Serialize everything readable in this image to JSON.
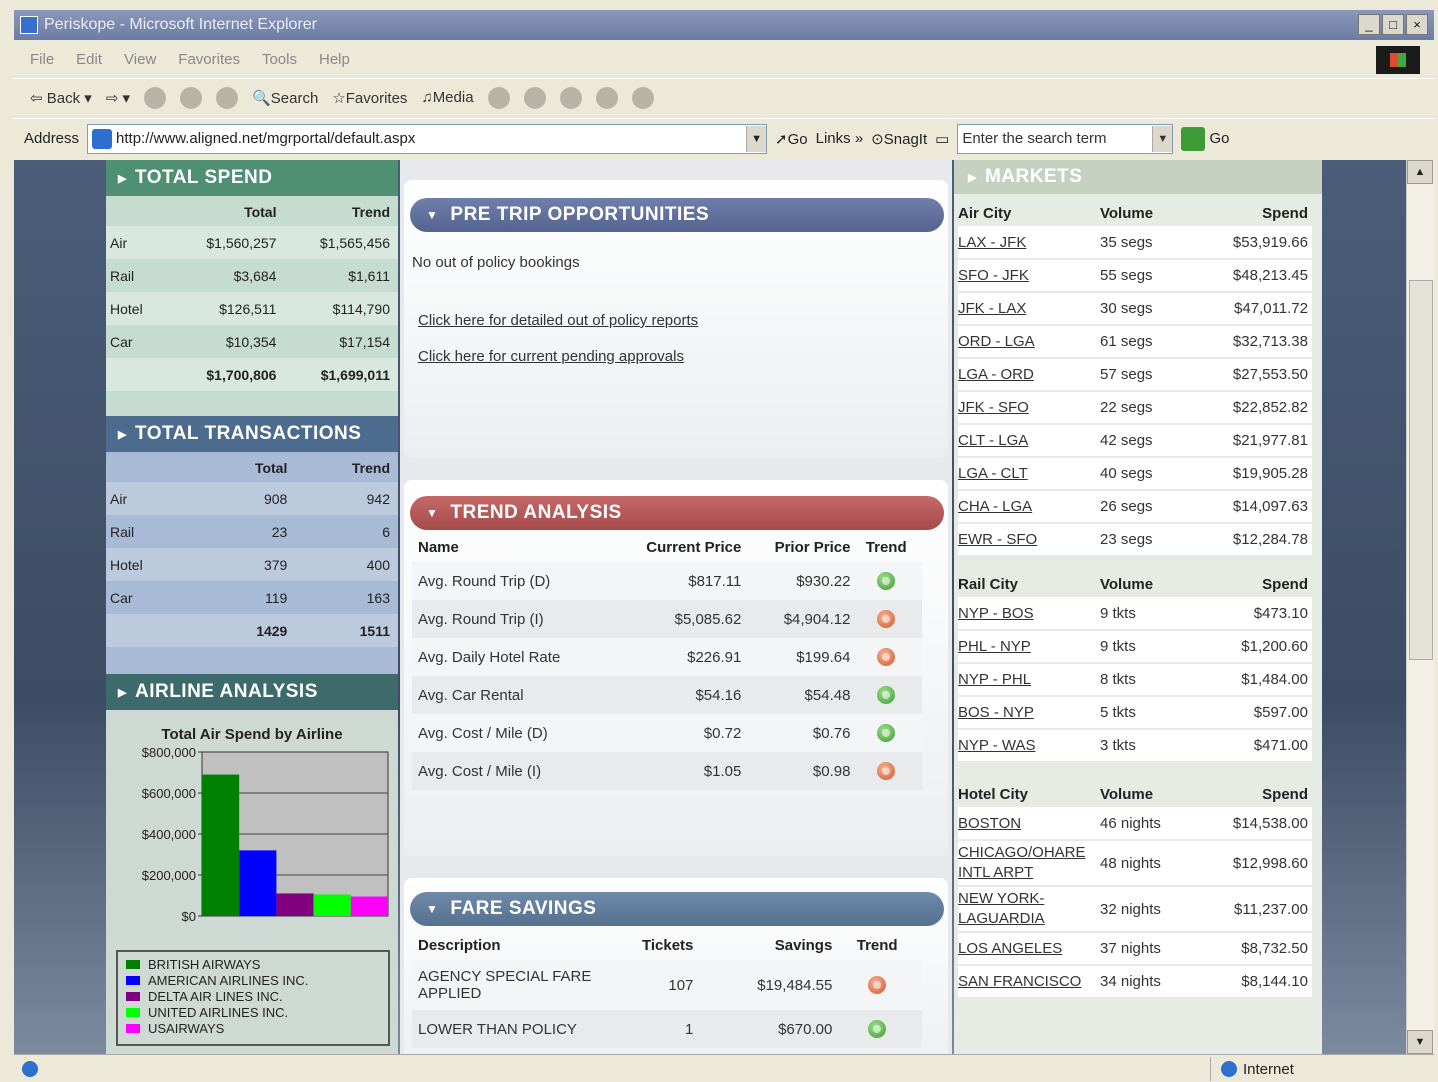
{
  "window": {
    "title": "Periskope - Microsoft Internet Explorer",
    "controls": [
      "_",
      "□",
      "×"
    ]
  },
  "menu": [
    "File",
    "Edit",
    "View",
    "Favorites",
    "Tools",
    "Help"
  ],
  "toolbar": {
    "back": "Back",
    "search": "Search",
    "favorites": "Favorites",
    "media": "Media"
  },
  "address": {
    "label": "Address",
    "url": "http://www.aligned.net/mgrportal/default.aspx",
    "go": "Go",
    "links": "Links",
    "snagit": "SnagIt",
    "search_placeholder": "Enter the search term",
    "go2": "Go"
  },
  "status": {
    "zone": "Internet"
  },
  "total_spend": {
    "title": "TOTAL SPEND",
    "headers": [
      "",
      "Total",
      "Trend"
    ],
    "rows": [
      {
        "label": "Air",
        "total": "$1,560,257",
        "trend": "$1,565,456"
      },
      {
        "label": "Rail",
        "total": "$3,684",
        "trend": "$1,611"
      },
      {
        "label": "Hotel",
        "total": "$126,511",
        "trend": "$114,790"
      },
      {
        "label": "Car",
        "total": "$10,354",
        "trend": "$17,154"
      }
    ],
    "sum_total": "$1,700,806",
    "sum_trend": "$1,699,011"
  },
  "total_transactions": {
    "title": "TOTAL TRANSACTIONS",
    "headers": [
      "",
      "Total",
      "Trend"
    ],
    "rows": [
      {
        "label": "Air",
        "total": "908",
        "trend": "942"
      },
      {
        "label": "Rail",
        "total": "23",
        "trend": "6"
      },
      {
        "label": "Hotel",
        "total": "379",
        "trend": "400"
      },
      {
        "label": "Car",
        "total": "119",
        "trend": "163"
      }
    ],
    "sum_total": "1429",
    "sum_trend": "1511"
  },
  "airline_analysis": {
    "title": "AIRLINE ANALYSIS"
  },
  "chart_data": {
    "type": "bar",
    "title": "Total Air Spend by Airline",
    "categories": [
      "BRITISH AIRWAYS",
      "AMERICAN AIRLINES INC.",
      "DELTA AIR LINES INC.",
      "UNITED AIRLINES INC.",
      "USAIRWAYS"
    ],
    "values": [
      690000,
      320000,
      110000,
      105000,
      95000
    ],
    "colors": [
      "#008000",
      "#0000ff",
      "#800080",
      "#00ff00",
      "#ff00ff"
    ],
    "ylim": [
      0,
      800000
    ],
    "yticks": [
      "$800,000",
      "$600,000",
      "$400,000",
      "$200,000",
      "$0"
    ],
    "grid": true,
    "legend": "bottom"
  },
  "pretrip": {
    "title": "PRE TRIP OPPORTUNITIES",
    "text": "No out of policy bookings",
    "link1": "Click here for detailed out of policy reports",
    "link2": "Click here for current pending approvals"
  },
  "trend_analysis": {
    "title": "TREND ANALYSIS",
    "headers": [
      "Name",
      "Current Price",
      "Prior Price",
      "Trend"
    ],
    "rows": [
      {
        "name": "Avg. Round Trip (D)",
        "current": "$817.11",
        "prior": "$930.22",
        "trend": "up"
      },
      {
        "name": "Avg. Round Trip (I)",
        "current": "$5,085.62",
        "prior": "$4,904.12",
        "trend": "down"
      },
      {
        "name": "Avg. Daily Hotel Rate",
        "current": "$226.91",
        "prior": "$199.64",
        "trend": "down"
      },
      {
        "name": "Avg. Car Rental",
        "current": "$54.16",
        "prior": "$54.48",
        "trend": "up"
      },
      {
        "name": "Avg. Cost / Mile (D)",
        "current": "$0.72",
        "prior": "$0.76",
        "trend": "up"
      },
      {
        "name": "Avg. Cost / Mile (I)",
        "current": "$1.05",
        "prior": "$0.98",
        "trend": "down"
      }
    ]
  },
  "fare_savings": {
    "title": "FARE SAVINGS",
    "headers": [
      "Description",
      "Tickets",
      "Savings",
      "Trend"
    ],
    "rows": [
      {
        "desc": "AGENCY SPECIAL FARE APPLIED",
        "tickets": "107",
        "savings": "$19,484.55",
        "trend": "down"
      },
      {
        "desc": "LOWER THAN POLICY",
        "tickets": "1",
        "savings": "$670.00",
        "trend": "up"
      }
    ]
  },
  "markets": {
    "title": "MARKETS",
    "air": {
      "headers": [
        "Air City",
        "Volume",
        "Spend"
      ],
      "rows": [
        {
          "city": "LAX - JFK",
          "volume": "35 segs",
          "spend": "$53,919.66"
        },
        {
          "city": "SFO - JFK",
          "volume": "55 segs",
          "spend": "$48,213.45"
        },
        {
          "city": "JFK - LAX",
          "volume": "30 segs",
          "spend": "$47,011.72"
        },
        {
          "city": "ORD - LGA",
          "volume": "61 segs",
          "spend": "$32,713.38"
        },
        {
          "city": "LGA - ORD",
          "volume": "57 segs",
          "spend": "$27,553.50"
        },
        {
          "city": "JFK - SFO",
          "volume": "22 segs",
          "spend": "$22,852.82"
        },
        {
          "city": "CLT - LGA",
          "volume": "42 segs",
          "spend": "$21,977.81"
        },
        {
          "city": "LGA - CLT",
          "volume": "40 segs",
          "spend": "$19,905.28"
        },
        {
          "city": "CHA - LGA",
          "volume": "26 segs",
          "spend": "$14,097.63"
        },
        {
          "city": "EWR - SFO",
          "volume": "23 segs",
          "spend": "$12,284.78"
        }
      ]
    },
    "rail": {
      "headers": [
        "Rail City",
        "Volume",
        "Spend"
      ],
      "rows": [
        {
          "city": "NYP - BOS",
          "volume": "9 tkts",
          "spend": "$473.10"
        },
        {
          "city": "PHL - NYP",
          "volume": "9 tkts",
          "spend": "$1,200.60"
        },
        {
          "city": "NYP - PHL",
          "volume": "8 tkts",
          "spend": "$1,484.00"
        },
        {
          "city": "BOS - NYP",
          "volume": "5 tkts",
          "spend": "$597.00"
        },
        {
          "city": "NYP - WAS",
          "volume": "3 tkts",
          "spend": "$471.00"
        }
      ]
    },
    "hotel": {
      "headers": [
        "Hotel City",
        "Volume",
        "Spend"
      ],
      "rows": [
        {
          "city": "BOSTON",
          "volume": "46 nights",
          "spend": "$14,538.00"
        },
        {
          "city": "CHICAGO/OHARE INTL ARPT",
          "volume": "48 nights",
          "spend": "$12,998.60"
        },
        {
          "city": "NEW YORK-LAGUARDIA",
          "volume": "32 nights",
          "spend": "$11,237.00"
        },
        {
          "city": "LOS ANGELES",
          "volume": "37 nights",
          "spend": "$8,732.50"
        },
        {
          "city": "SAN FRANCISCO",
          "volume": "34 nights",
          "spend": "$8,144.10"
        }
      ]
    }
  }
}
